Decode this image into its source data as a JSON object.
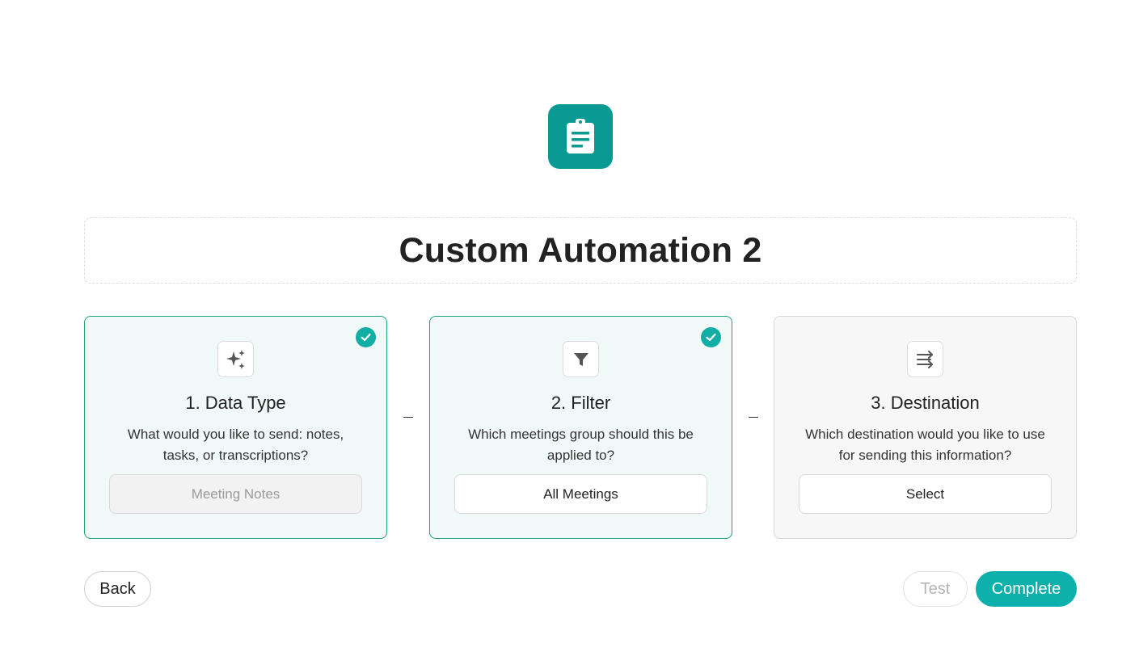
{
  "header": {
    "icon": "clipboard-icon",
    "title": "Custom Automation 2"
  },
  "colors": {
    "accent": "#0db0ab",
    "app_icon_bg": "#0a9a93",
    "completed_border": "#1fa37a",
    "completed_bg": "#f1f9f8"
  },
  "steps": [
    {
      "icon": "sparkles-icon",
      "title": "1. Data Type",
      "description": "What would you like to send: notes, tasks, or transcriptions?",
      "field_value": "Meeting Notes",
      "completed": true
    },
    {
      "icon": "filter-icon",
      "title": "2. Filter",
      "description": "Which meetings group should this be applied to?",
      "field_value": "All Meetings",
      "completed": true
    },
    {
      "icon": "arrows-flow-icon",
      "title": "3. Destination",
      "description": "Which destination would you like to use for sending this information?",
      "field_value": "Select",
      "completed": false
    }
  ],
  "footer": {
    "back_label": "Back",
    "test_label": "Test",
    "complete_label": "Complete"
  }
}
